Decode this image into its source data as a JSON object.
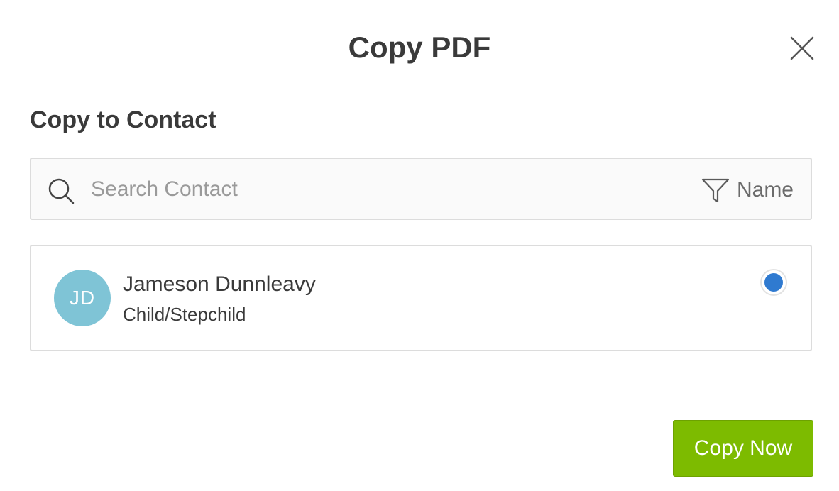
{
  "dialog": {
    "title": "Copy PDF",
    "close_icon": "close-icon"
  },
  "section": {
    "heading": "Copy to Contact"
  },
  "search": {
    "placeholder": "Search Contact",
    "value": "",
    "icon": "search-icon",
    "sort_icon": "filter-icon",
    "sort_label": "Name"
  },
  "contacts": [
    {
      "initials": "JD",
      "name": "Jameson Dunnleavy",
      "relation": "Child/Stepchild",
      "selected": true,
      "avatar_color": "#7fc4d6"
    }
  ],
  "actions": {
    "copy_now_label": "Copy Now"
  },
  "colors": {
    "accent_green": "#7dbb00",
    "radio_selected_blue": "#2f7ad0",
    "text_dark": "#3a3a3a"
  }
}
